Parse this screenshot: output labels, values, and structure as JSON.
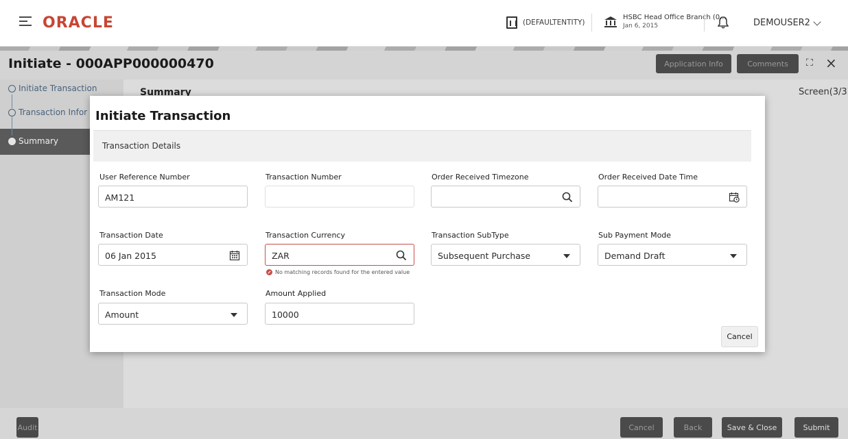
{
  "header": {
    "brand": "ORACLE",
    "entity": "(DEFAULTENTITY)",
    "branch_name": "HSBC Head Office Branch (0...",
    "branch_date": "Jan 6, 2015",
    "user": "DEMOUSER2"
  },
  "page": {
    "title": "Initiate - 000APP000000470",
    "application_info_label": "Application Info",
    "comments_label": "Comments",
    "section_heading": "Summary",
    "screen_indicator": "Screen(3/3)"
  },
  "steps": [
    {
      "label": "Initiate Transaction"
    },
    {
      "label": "Transaction Infor"
    },
    {
      "label": "Summary"
    }
  ],
  "footer": {
    "audit_label": "Audit",
    "cancel_label": "Cancel",
    "back_label": "Back",
    "save_close_label": "Save & Close",
    "submit_label": "Submit"
  },
  "modal": {
    "title": "Initiate Transaction",
    "section": "Transaction Details",
    "cancel_label": "Cancel",
    "fields": {
      "user_reference_number": {
        "label": "User Reference Number",
        "value": "AM121"
      },
      "transaction_number": {
        "label": "Transaction Number",
        "value": ""
      },
      "order_received_timezone": {
        "label": "Order Received Timezone",
        "value": ""
      },
      "order_received_date_time": {
        "label": "Order Received Date Time",
        "value": ""
      },
      "transaction_date": {
        "label": "Transaction Date",
        "value": "06 Jan 2015"
      },
      "transaction_currency": {
        "label": "Transaction Currency",
        "value": "ZAR",
        "error": "No matching records found for the entered value"
      },
      "transaction_subtype": {
        "label": "Transaction SubType",
        "value": "Subsequent Purchase"
      },
      "sub_payment_mode": {
        "label": "Sub Payment Mode",
        "value": "Demand Draft"
      },
      "transaction_mode": {
        "label": "Transaction Mode",
        "value": "Amount"
      },
      "amount_applied": {
        "label": "Amount Applied",
        "value": "10000"
      }
    }
  },
  "colors": {
    "brand": "#c74634",
    "error": "#c7504a",
    "overlay_button": "#4a4a4a"
  }
}
